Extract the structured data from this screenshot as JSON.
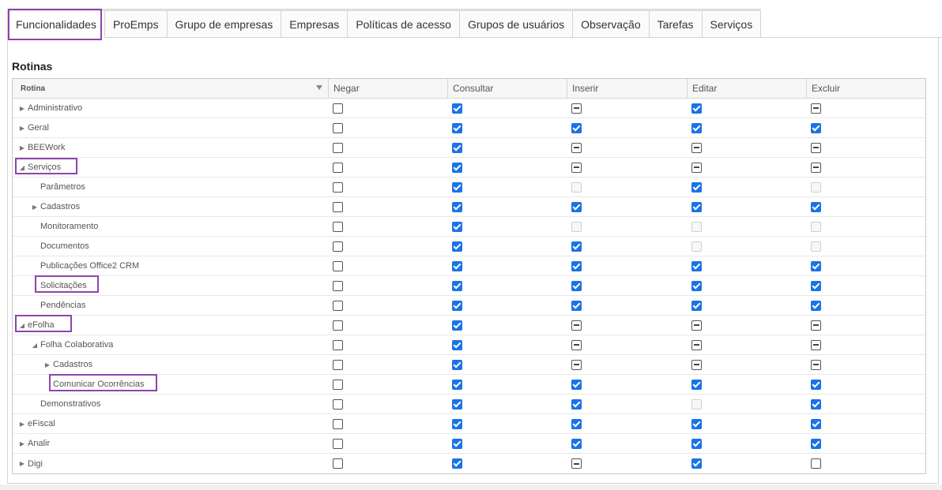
{
  "tabs": [
    {
      "label": "Funcionalidades",
      "active": true
    },
    {
      "label": "ProEmps",
      "active": false
    },
    {
      "label": "Grupo de empresas",
      "active": false
    },
    {
      "label": "Empresas",
      "active": false
    },
    {
      "label": "Políticas de acesso",
      "active": false
    },
    {
      "label": "Grupos de usuários",
      "active": false
    },
    {
      "label": "Observação",
      "active": false
    },
    {
      "label": "Tarefas",
      "active": false
    },
    {
      "label": "Serviços",
      "active": false
    }
  ],
  "section_title": "Rotinas",
  "columns": [
    "Rotina",
    "Negar",
    "Consultar",
    "Inserir",
    "Editar",
    "Excluir"
  ],
  "rows": [
    {
      "label": "Administrativo",
      "level": 0,
      "expander": "collapsed",
      "states": [
        "unchecked",
        "checked",
        "partial",
        "checked",
        "partial"
      ]
    },
    {
      "label": "Geral",
      "level": 0,
      "expander": "collapsed",
      "states": [
        "unchecked",
        "checked",
        "checked",
        "checked",
        "checked"
      ]
    },
    {
      "label": "BEEWork",
      "level": 0,
      "expander": "collapsed",
      "states": [
        "unchecked",
        "checked",
        "partial",
        "partial",
        "partial"
      ]
    },
    {
      "label": "Serviços",
      "level": 0,
      "expander": "expanded",
      "states": [
        "unchecked",
        "checked",
        "partial",
        "partial",
        "partial"
      ]
    },
    {
      "label": "Parâmetros",
      "level": 1,
      "expander": "none",
      "states": [
        "unchecked",
        "checked",
        "disabled",
        "checked",
        "disabled"
      ]
    },
    {
      "label": "Cadastros",
      "level": 1,
      "expander": "collapsed",
      "states": [
        "unchecked",
        "checked",
        "checked",
        "checked",
        "checked"
      ]
    },
    {
      "label": "Monitoramento",
      "level": 1,
      "expander": "none",
      "states": [
        "unchecked",
        "checked",
        "disabled",
        "disabled",
        "disabled"
      ]
    },
    {
      "label": "Documentos",
      "level": 1,
      "expander": "none",
      "states": [
        "unchecked",
        "checked",
        "checked",
        "disabled",
        "disabled"
      ]
    },
    {
      "label": "Publicações Office2 CRM",
      "level": 1,
      "expander": "none",
      "states": [
        "unchecked",
        "checked",
        "checked",
        "checked",
        "checked"
      ]
    },
    {
      "label": "Solicitações",
      "level": 1,
      "expander": "none",
      "states": [
        "unchecked",
        "checked",
        "checked",
        "checked",
        "checked"
      ]
    },
    {
      "label": "Pendências",
      "level": 1,
      "expander": "none",
      "states": [
        "unchecked",
        "checked",
        "checked",
        "checked",
        "checked"
      ]
    },
    {
      "label": "eFolha",
      "level": 0,
      "expander": "expanded",
      "states": [
        "unchecked",
        "checked",
        "partial",
        "partial",
        "partial"
      ]
    },
    {
      "label": "Folha Colaborativa",
      "level": 1,
      "expander": "expanded",
      "states": [
        "unchecked",
        "checked",
        "partial",
        "partial",
        "partial"
      ]
    },
    {
      "label": "Cadastros",
      "level": 2,
      "expander": "collapsed",
      "states": [
        "unchecked",
        "checked",
        "partial",
        "partial",
        "partial"
      ]
    },
    {
      "label": "Comunicar Ocorrências",
      "level": 2,
      "expander": "none",
      "states": [
        "unchecked",
        "checked",
        "checked",
        "checked",
        "checked"
      ]
    },
    {
      "label": "Demonstrativos",
      "level": 1,
      "expander": "none",
      "states": [
        "unchecked",
        "checked",
        "checked",
        "disabled",
        "checked"
      ]
    },
    {
      "label": "eFiscal",
      "level": 0,
      "expander": "collapsed",
      "states": [
        "unchecked",
        "checked",
        "checked",
        "checked",
        "checked"
      ]
    },
    {
      "label": "Analir",
      "level": 0,
      "expander": "collapsed",
      "states": [
        "unchecked",
        "checked",
        "checked",
        "checked",
        "checked"
      ]
    },
    {
      "label": "Digi",
      "level": 0,
      "expander": "collapsed",
      "states": [
        "unchecked",
        "checked",
        "partial",
        "checked",
        "unchecked"
      ]
    }
  ],
  "colors": {
    "accent": "#1a73e8",
    "highlight": "#8e44ad"
  },
  "icons": {
    "expanded": "triangle-down-icon",
    "collapsed": "triangle-right-icon",
    "filter": "filter-icon"
  }
}
